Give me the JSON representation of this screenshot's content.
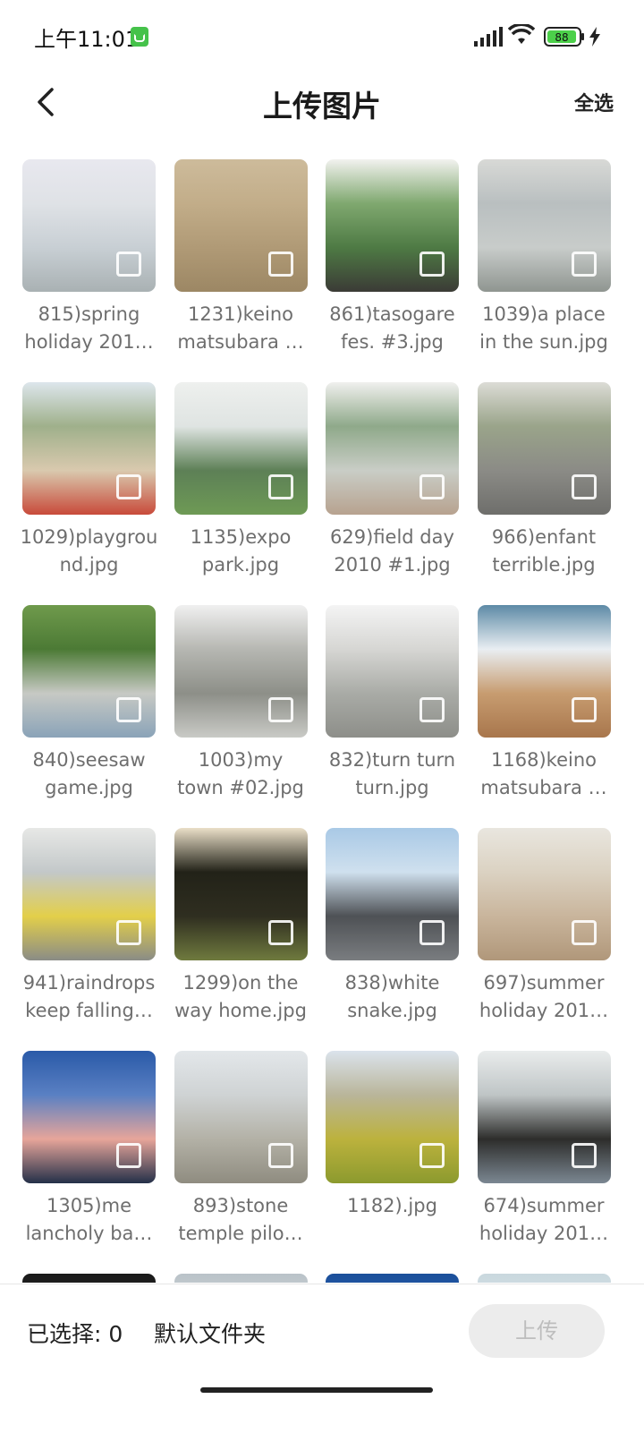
{
  "status_bar": {
    "time": "上午11:01",
    "battery_level": "88"
  },
  "header": {
    "title": "上传图片",
    "select_all_label": "全选"
  },
  "photos": [
    {
      "line1": "815)spring",
      "line2": "holiday 201…",
      "colors": [
        "#e8e8ef",
        "#dfe2e6",
        "#c8cfd4",
        "#a9b1b3"
      ]
    },
    {
      "line1": "1231)keino",
      "line2": "matsubara …",
      "colors": [
        "#cdbb9b",
        "#c2ad89",
        "#b09a76",
        "#9c8764"
      ]
    },
    {
      "line1": "861)tasogare",
      "line2": "fes. #3.jpg",
      "colors": [
        "#f2f2ef",
        "#7fa86f",
        "#4e7a44",
        "#3b3b36"
      ]
    },
    {
      "line1": "1039)a place",
      "line2": "in the sun.jpg",
      "colors": [
        "#d8d9d6",
        "#b9bfc0",
        "#c8ccca",
        "#8f9590"
      ]
    },
    {
      "line1": "1029)playgrou",
      "line2": "nd.jpg",
      "colors": [
        "#dde6ec",
        "#9fb08b",
        "#d9c9ae",
        "#c84a3a"
      ]
    },
    {
      "line1": "1135)expo",
      "line2": "park.jpg",
      "colors": [
        "#eef0ee",
        "#dfe4e2",
        "#5d8056",
        "#6e9a55"
      ]
    },
    {
      "line1": "629)field day",
      "line2": "2010 #1.jpg",
      "colors": [
        "#f0f0ee",
        "#8fa98a",
        "#c9cdc6",
        "#b7a28f"
      ]
    },
    {
      "line1": "966)enfant",
      "line2": "terrible.jpg",
      "colors": [
        "#dcdcd6",
        "#9aa48a",
        "#8b8b86",
        "#6e6e6b"
      ]
    },
    {
      "line1": "840)seesaw",
      "line2": "game.jpg",
      "colors": [
        "#6f9a4c",
        "#4c7a35",
        "#c7c9c4",
        "#8aa3b8"
      ]
    },
    {
      "line1": "1003)my",
      "line2": "town #02.jpg",
      "colors": [
        "#f0f0f0",
        "#b6b7b2",
        "#8d8f88",
        "#c9cac6"
      ]
    },
    {
      "line1": "832)turn turn",
      "line2": "turn.jpg",
      "colors": [
        "#f4f4f4",
        "#d6d6d3",
        "#a9aba6",
        "#8d8e89"
      ]
    },
    {
      "line1": "1168)keino",
      "line2": "matsubara …",
      "colors": [
        "#5d8aa6",
        "#e9eef2",
        "#c79c70",
        "#a8764c"
      ]
    },
    {
      "line1": "941)raindrops",
      "line2": "keep falling…",
      "colors": [
        "#e7e8e6",
        "#c3c8c9",
        "#e3cf4a",
        "#8a8c86"
      ]
    },
    {
      "line1": "1299)on the",
      "line2": "way home.jpg",
      "colors": [
        "#eadfc8",
        "#222218",
        "#2f2e20",
        "#6f7a3e"
      ]
    },
    {
      "line1": "838)white",
      "line2": "snake.jpg",
      "colors": [
        "#a9c9e6",
        "#cfe0ee",
        "#4e5155",
        "#7a7d80"
      ]
    },
    {
      "line1": "697)summer",
      "line2": "holiday 201…",
      "colors": [
        "#e9e6df",
        "#dbd2c2",
        "#c9b59c",
        "#b0977a"
      ]
    },
    {
      "line1": "1305)me",
      "line2": "lancholy ba…",
      "colors": [
        "#2a5aa8",
        "#5a80c3",
        "#e7a59a",
        "#243049"
      ]
    },
    {
      "line1": "893)stone",
      "line2": "temple pilo…",
      "colors": [
        "#e3e7ea",
        "#cfd3d4",
        "#b3b1a6",
        "#8f8c80"
      ]
    },
    {
      "line1": "1182).jpg",
      "line2": "",
      "colors": [
        "#dbe3ec",
        "#b9b59a",
        "#bcb23d",
        "#8c9a2e"
      ]
    },
    {
      "line1": "674)summer",
      "line2": "holiday 201…",
      "colors": [
        "#e9ecec",
        "#bfc5c6",
        "#2d2d2b",
        "#7b8792"
      ]
    },
    {
      "line1": "",
      "line2": "",
      "colors": [
        "#1a1a1a",
        "#2a2a2a",
        "#333333",
        "#3a3a3a"
      ]
    },
    {
      "line1": "",
      "line2": "",
      "colors": [
        "#b9c2c8",
        "#d6dadb",
        "#c7ccce",
        "#aab1b4"
      ]
    },
    {
      "line1": "",
      "line2": "",
      "colors": [
        "#1b4f9a",
        "#2a62b0",
        "#3873c0",
        "#4a80c8"
      ]
    },
    {
      "line1": "",
      "line2": "",
      "colors": [
        "#c9d8de",
        "#dbe4e8",
        "#e4eaec",
        "#d4dde1"
      ]
    }
  ],
  "bottom_bar": {
    "selected_label": "已选择: 0",
    "folder_label": "默认文件夹",
    "upload_label": "上传"
  }
}
